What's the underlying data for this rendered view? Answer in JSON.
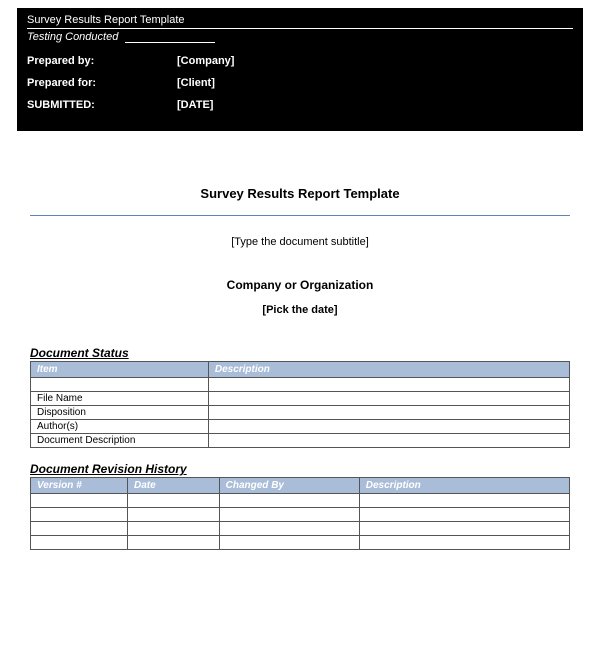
{
  "header": {
    "title": "Survey Results Report Template",
    "subtitle": "Testing Conducted",
    "preparedByLabel": "Prepared by:",
    "preparedByValue": "[Company]",
    "preparedForLabel": "Prepared for:",
    "preparedForValue": "[Client]",
    "submittedLabel": "SUBMITTED:",
    "submittedValue": "[DATE]"
  },
  "main": {
    "title": "Survey Results Report Template",
    "subtitlePlaceholder": "[Type the document subtitle]",
    "company": "Company or Organization",
    "datePlaceholder": "[Pick the date]"
  },
  "statusSection": {
    "title": "Document Status",
    "headers": {
      "item": "Item",
      "description": "Description"
    },
    "rows": [
      {
        "item": "",
        "description": ""
      },
      {
        "item": "File Name",
        "description": ""
      },
      {
        "item": "Disposition",
        "description": ""
      },
      {
        "item": "Author(s)",
        "description": ""
      },
      {
        "item": "Document Description",
        "description": ""
      }
    ]
  },
  "historySection": {
    "title": "Document Revision History",
    "headers": {
      "version": "Version #",
      "date": "Date",
      "changedBy": "Changed By",
      "description": "Description"
    },
    "rows": [
      {
        "version": "",
        "date": "",
        "changedBy": "",
        "description": ""
      },
      {
        "version": "",
        "date": "",
        "changedBy": "",
        "description": ""
      },
      {
        "version": "",
        "date": "",
        "changedBy": "",
        "description": ""
      },
      {
        "version": "",
        "date": "",
        "changedBy": "",
        "description": ""
      }
    ]
  }
}
